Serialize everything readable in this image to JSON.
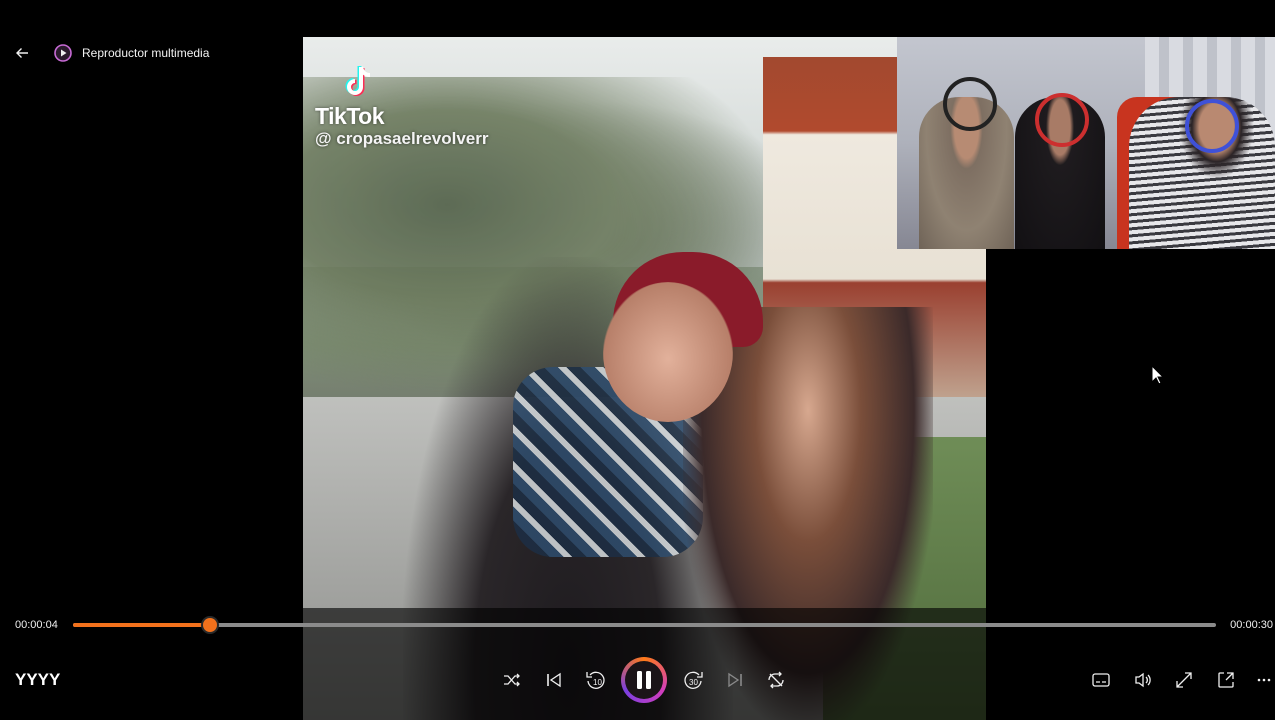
{
  "app": {
    "title": "Reproductor multimedia",
    "accent_color": "#f2711c"
  },
  "overlay": {
    "brand": "TikTok",
    "handle": "@ cropasaelrevolverr"
  },
  "playback": {
    "current_time": "00:00:04",
    "total_time": "00:00:30",
    "progress": 0.12,
    "now_playing": "YYYY",
    "state": "playing"
  },
  "icons": {
    "back": "back-arrow-icon",
    "app": "media-player-icon",
    "shuffle": "shuffle-icon",
    "previous": "previous-icon",
    "rewind": "rewind-10-icon",
    "pause": "pause-icon",
    "forward": "forward-30-icon",
    "next": "next-icon",
    "repeat": "repeat-icon",
    "subtitles": "subtitles-icon",
    "volume": "volume-icon",
    "fullscreen": "fullscreen-icon",
    "miniplayer": "miniplayer-icon",
    "more": "more-icon"
  },
  "labels": {
    "rewind_seconds": "10",
    "forward_seconds": "30"
  }
}
